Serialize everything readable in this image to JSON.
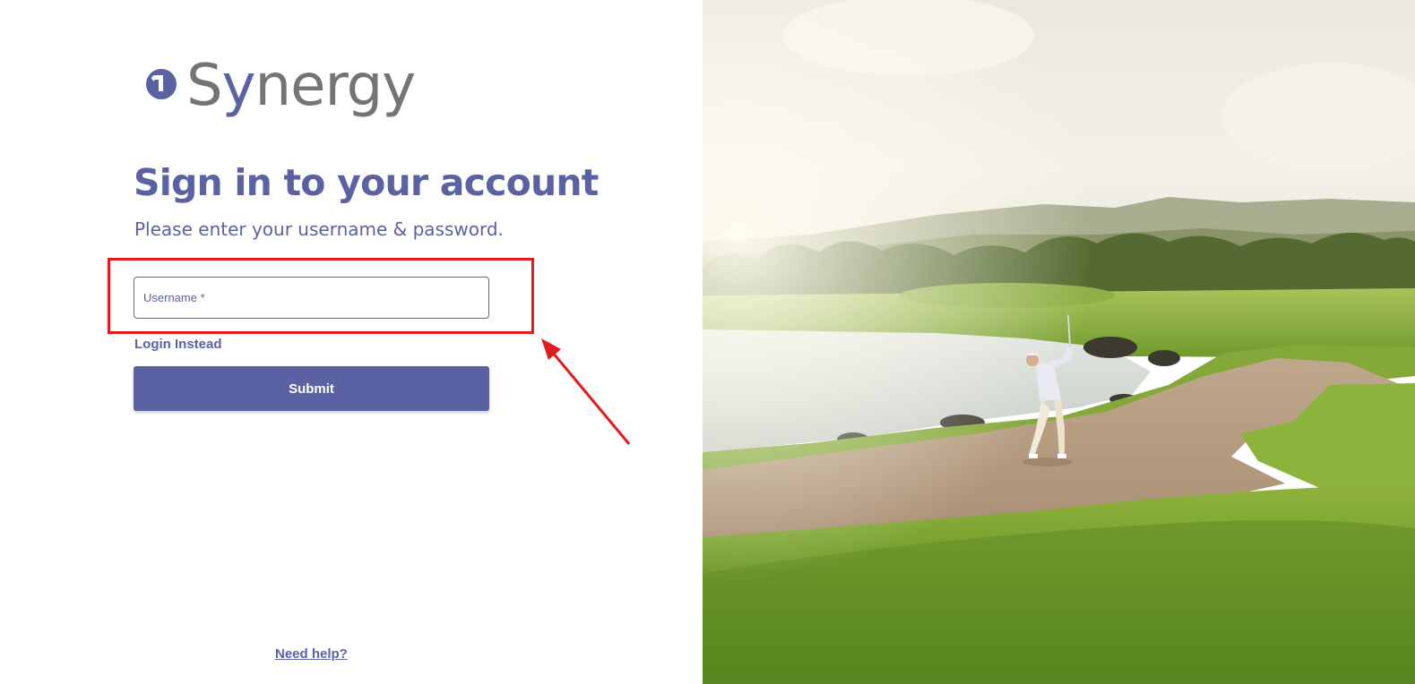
{
  "brand": {
    "name_part1": "S",
    "name_accent": "y",
    "name_part2": "nergy",
    "logo_mark_icon": "synergy-circle-mark-icon",
    "primary_color": "#5a62a3",
    "logo_gray": "#747474"
  },
  "login": {
    "title": "Sign in to your account",
    "subtitle": "Please enter your username & password.",
    "username_placeholder": "Username *",
    "username_value": "",
    "login_instead": "Login Instead",
    "submit_label": "Submit",
    "need_help": "Need help?"
  },
  "annotation": {
    "color": "#e31b1b",
    "highlight_target": "username-field",
    "arrow_icon": "arrow-pointer-icon"
  },
  "hero_image": {
    "subject": "golfer-in-bunker-photo"
  }
}
